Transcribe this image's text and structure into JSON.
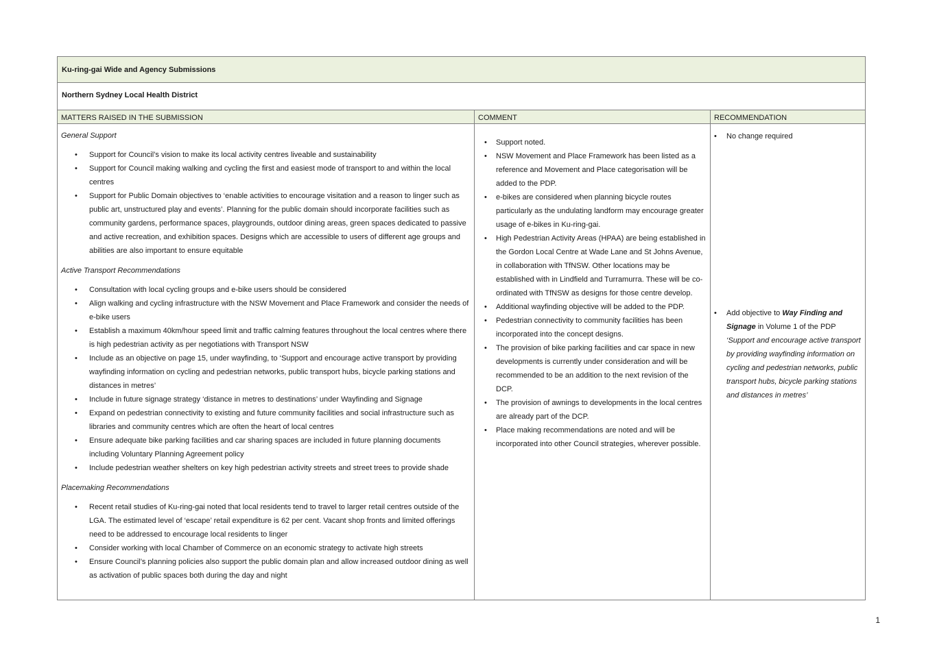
{
  "title": "Ku-ring-gai Wide and Agency Submissions",
  "submitter": "Northern Sydney Local Health District",
  "headers": {
    "matters": "MATTERS RAISED IN THE SUBMISSION",
    "comment": "COMMENT",
    "recommendation": "RECOMMENDATION"
  },
  "matters": {
    "general_support": {
      "heading": "General Support",
      "items": [
        "Support for Council’s vision to make its local activity centres liveable and sustainability",
        "Support for Council making walking and cycling the first and easiest mode of transport to and within the local centres",
        "Support for Public Domain objectives to ‘enable activities to encourage visitation and a reason to linger such as public art, unstructured play and events’. Planning for the public domain should incorporate facilities such as community gardens, performance spaces, playgrounds, outdoor dining areas, green spaces dedicated to passive and active recreation, and exhibition spaces. Designs which are accessible to users of different age groups and abilities are also important to ensure equitable"
      ]
    },
    "active_transport": {
      "heading": "Active Transport Recommendations",
      "items": [
        "Consultation with local cycling groups and e-bike users should be considered",
        "Align walking and cycling infrastructure with the NSW Movement and Place Framework and consider the needs of e-bike users",
        "Establish a maximum 40km/hour speed limit and traffic calming features throughout the local centres where there is high pedestrian activity as per negotiations with Transport NSW",
        "Include as an objective on page 15, under wayfinding, to ‘Support and encourage active transport by providing wayfinding information on cycling and pedestrian networks, public transport hubs, bicycle parking stations and distances in metres’",
        "Include in future signage strategy ‘distance in metres to destinations’ under Wayfinding and Signage",
        "Expand on pedestrian connectivity to existing and future community facilities and social infrastructure such as libraries and community centres which are often the heart of local centres",
        "Ensure adequate bike parking facilities and car sharing spaces are included in future planning documents including Voluntary Planning Agreement policy",
        "Include pedestrian weather shelters on key high pedestrian activity streets and street trees to provide shade"
      ]
    },
    "placemaking": {
      "heading": "Placemaking Recommendations",
      "items": [
        "Recent retail studies of Ku-ring-gai noted that local residents tend to travel to larger retail centres outside of the LGA. The estimated level of ‘escape’ retail expenditure is 62 per cent. Vacant shop fronts and limited offerings need to be addressed to encourage local residents to linger",
        "Consider working with local Chamber of Commerce on an economic strategy to activate high streets",
        "Ensure Council’s planning policies also support the public domain plan and allow increased outdoor dining as well as activation of public spaces both during the day and night"
      ]
    }
  },
  "comments": [
    "Support noted.",
    "NSW Movement and Place Framework has been listed as a reference and Movement and Place categorisation will be added to the PDP.",
    "e-bikes are considered when planning bicycle routes particularly as the undulating landform may encourage greater usage of e-bikes in Ku-ring-gai.",
    "High Pedestrian Activity Areas (HPAA) are being established in the Gordon Local Centre at Wade Lane and St Johns Avenue, in collaboration with TfNSW. Other locations may be established with in Lindfield and Turramurra. These will be co-ordinated with TfNSW as designs for those centre develop.",
    "Additional wayfinding objective will be added to the PDP.",
    "Pedestrian connectivity to community facilities has been incorporated into the concept designs.",
    "The provision of bike parking facilities and car space in new developments is currently under consideration and will be recommended to be an addition to the next revision of the DCP.",
    "The provision of awnings to developments in the local centres are already part of the DCP.",
    "Place making recommendations are noted and will be incorporated into other Council strategies, wherever possible."
  ],
  "recommendations": {
    "first": "No change required",
    "second": {
      "prefix": "Add objective to ",
      "emphasis": "Way Finding and Signage",
      "suffix": " in Volume 1 of the PDP ",
      "quote": "‘Support and encourage active transport by providing wayfinding information on cycling and pedestrian networks, public transport hubs, bicycle parking stations and distances in metres’"
    }
  },
  "page_number": "1"
}
